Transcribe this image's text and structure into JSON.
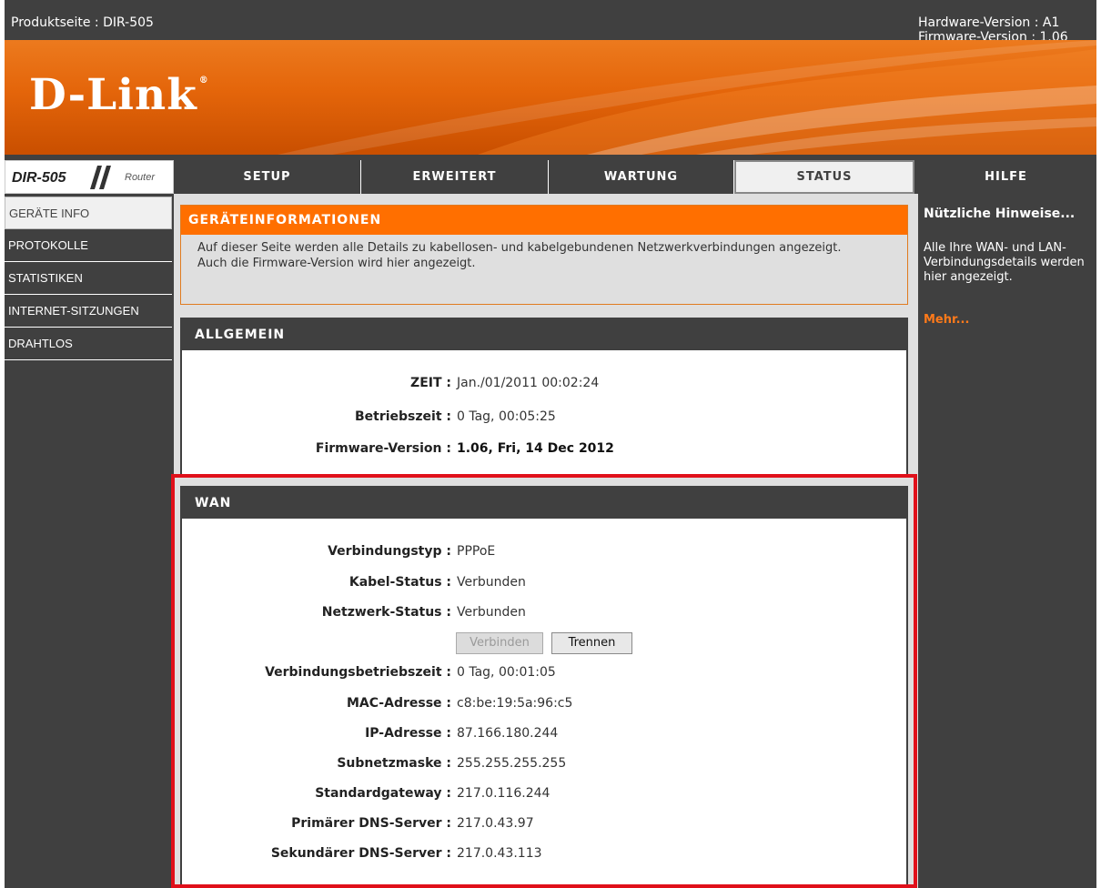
{
  "topbar": {
    "product": "Produktseite : DIR-505",
    "hardware": "Hardware-Version : A1",
    "firmware": "Firmware-Version : 1.06"
  },
  "brand": {
    "logo": "D-Link",
    "reg": "®"
  },
  "model": {
    "name": "DIR-505",
    "type": "Router"
  },
  "tabs": [
    {
      "label": "SETUP",
      "active": false
    },
    {
      "label": "ERWEITERT",
      "active": false
    },
    {
      "label": "WARTUNG",
      "active": false
    },
    {
      "label": "STATUS",
      "active": true
    },
    {
      "label": "HILFE",
      "active": false
    }
  ],
  "sidebar": {
    "items": [
      {
        "label": "GERÄTE INFO",
        "active": true
      },
      {
        "label": "PROTOKOLLE",
        "active": false
      },
      {
        "label": "STATISTIKEN",
        "active": false
      },
      {
        "label": "INTERNET-SITZUNGEN",
        "active": false
      },
      {
        "label": "DRAHTLOS",
        "active": false
      }
    ]
  },
  "info": {
    "title": "GERÄTEINFORMATIONEN",
    "text": "Auf dieser Seite werden alle Details zu kabellosen- und kabelgebundenen Netzwerkverbindungen angezeigt. Auch die Firmware-Version wird hier angezeigt."
  },
  "general": {
    "title": "ALLGEMEIN",
    "rows": [
      {
        "label": "ZEIT :",
        "value": "Jan./01/2011 00:02:24"
      },
      {
        "label": "Betriebszeit :",
        "value": "0 Tag, 00:05:25"
      },
      {
        "label": "Firmware-Version :",
        "value": "1.06,  Fri, 14 Dec 2012"
      }
    ]
  },
  "wan": {
    "title": "WAN",
    "rows": [
      {
        "label": "Verbindungstyp :",
        "value": "PPPoE"
      },
      {
        "label": "Kabel-Status :",
        "value": "Verbunden"
      },
      {
        "label": "Netzwerk-Status :",
        "value": "Verbunden"
      },
      {
        "label": "Verbindungsbetriebszeit :",
        "value": "0 Tag, 00:01:05"
      },
      {
        "label": "MAC-Adresse :",
        "value": "c8:be:19:5a:96:c5"
      },
      {
        "label": "IP-Adresse :",
        "value": "87.166.180.244"
      },
      {
        "label": "Subnetzmaske :",
        "value": "255.255.255.255"
      },
      {
        "label": "Standardgateway :",
        "value": "217.0.116.244"
      },
      {
        "label": "Primärer DNS-Server :",
        "value": "217.0.43.97"
      },
      {
        "label": "Sekundärer DNS-Server :",
        "value": "217.0.43.113"
      }
    ],
    "connect_label": "Verbinden",
    "connect_enabled": false,
    "disconnect_label": "Trennen"
  },
  "hints": {
    "title": "Nützliche Hinweise...",
    "text": "Alle Ihre WAN- und LAN-Verbindungsdetails werden hier angezeigt.",
    "more": "Mehr..."
  },
  "colors": {
    "accent": "#ff6f00",
    "dark": "#404040",
    "highlight_frame": "#e0101a"
  }
}
